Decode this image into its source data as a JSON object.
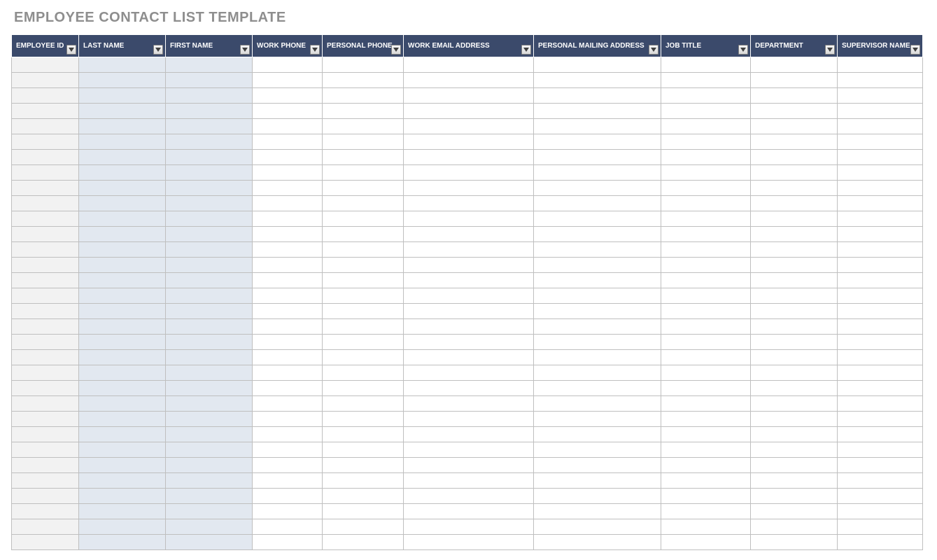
{
  "title": "EMPLOYEE CONTACT LIST TEMPLATE",
  "columns": [
    "EMPLOYEE ID",
    "LAST NAME",
    "FIRST NAME",
    "WORK PHONE",
    "PERSONAL PHONE",
    "WORK EMAIL ADDRESS",
    "PERSONAL MAILING ADDRESS",
    "JOB TITLE",
    "DEPARTMENT",
    "SUPERVISOR NAME"
  ],
  "row_count": 32,
  "rows": [
    [
      "",
      "",
      "",
      "",
      "",
      "",
      "",
      "",
      "",
      ""
    ],
    [
      "",
      "",
      "",
      "",
      "",
      "",
      "",
      "",
      "",
      ""
    ],
    [
      "",
      "",
      "",
      "",
      "",
      "",
      "",
      "",
      "",
      ""
    ],
    [
      "",
      "",
      "",
      "",
      "",
      "",
      "",
      "",
      "",
      ""
    ],
    [
      "",
      "",
      "",
      "",
      "",
      "",
      "",
      "",
      "",
      ""
    ],
    [
      "",
      "",
      "",
      "",
      "",
      "",
      "",
      "",
      "",
      ""
    ],
    [
      "",
      "",
      "",
      "",
      "",
      "",
      "",
      "",
      "",
      ""
    ],
    [
      "",
      "",
      "",
      "",
      "",
      "",
      "",
      "",
      "",
      ""
    ],
    [
      "",
      "",
      "",
      "",
      "",
      "",
      "",
      "",
      "",
      ""
    ],
    [
      "",
      "",
      "",
      "",
      "",
      "",
      "",
      "",
      "",
      ""
    ],
    [
      "",
      "",
      "",
      "",
      "",
      "",
      "",
      "",
      "",
      ""
    ],
    [
      "",
      "",
      "",
      "",
      "",
      "",
      "",
      "",
      "",
      ""
    ],
    [
      "",
      "",
      "",
      "",
      "",
      "",
      "",
      "",
      "",
      ""
    ],
    [
      "",
      "",
      "",
      "",
      "",
      "",
      "",
      "",
      "",
      ""
    ],
    [
      "",
      "",
      "",
      "",
      "",
      "",
      "",
      "",
      "",
      ""
    ],
    [
      "",
      "",
      "",
      "",
      "",
      "",
      "",
      "",
      "",
      ""
    ],
    [
      "",
      "",
      "",
      "",
      "",
      "",
      "",
      "",
      "",
      ""
    ],
    [
      "",
      "",
      "",
      "",
      "",
      "",
      "",
      "",
      "",
      ""
    ],
    [
      "",
      "",
      "",
      "",
      "",
      "",
      "",
      "",
      "",
      ""
    ],
    [
      "",
      "",
      "",
      "",
      "",
      "",
      "",
      "",
      "",
      ""
    ],
    [
      "",
      "",
      "",
      "",
      "",
      "",
      "",
      "",
      "",
      ""
    ],
    [
      "",
      "",
      "",
      "",
      "",
      "",
      "",
      "",
      "",
      ""
    ],
    [
      "",
      "",
      "",
      "",
      "",
      "",
      "",
      "",
      "",
      ""
    ],
    [
      "",
      "",
      "",
      "",
      "",
      "",
      "",
      "",
      "",
      ""
    ],
    [
      "",
      "",
      "",
      "",
      "",
      "",
      "",
      "",
      "",
      ""
    ],
    [
      "",
      "",
      "",
      "",
      "",
      "",
      "",
      "",
      "",
      ""
    ],
    [
      "",
      "",
      "",
      "",
      "",
      "",
      "",
      "",
      "",
      ""
    ],
    [
      "",
      "",
      "",
      "",
      "",
      "",
      "",
      "",
      "",
      ""
    ],
    [
      "",
      "",
      "",
      "",
      "",
      "",
      "",
      "",
      "",
      ""
    ],
    [
      "",
      "",
      "",
      "",
      "",
      "",
      "",
      "",
      "",
      ""
    ],
    [
      "",
      "",
      "",
      "",
      "",
      "",
      "",
      "",
      "",
      ""
    ],
    [
      "",
      "",
      "",
      "",
      "",
      "",
      "",
      "",
      "",
      ""
    ]
  ],
  "colors": {
    "header_bg": "#3b4a6b",
    "title_color": "#8e8e8e",
    "col_a_bg": "#f2f2f2",
    "col_bc_bg": "#e2e8f0"
  }
}
